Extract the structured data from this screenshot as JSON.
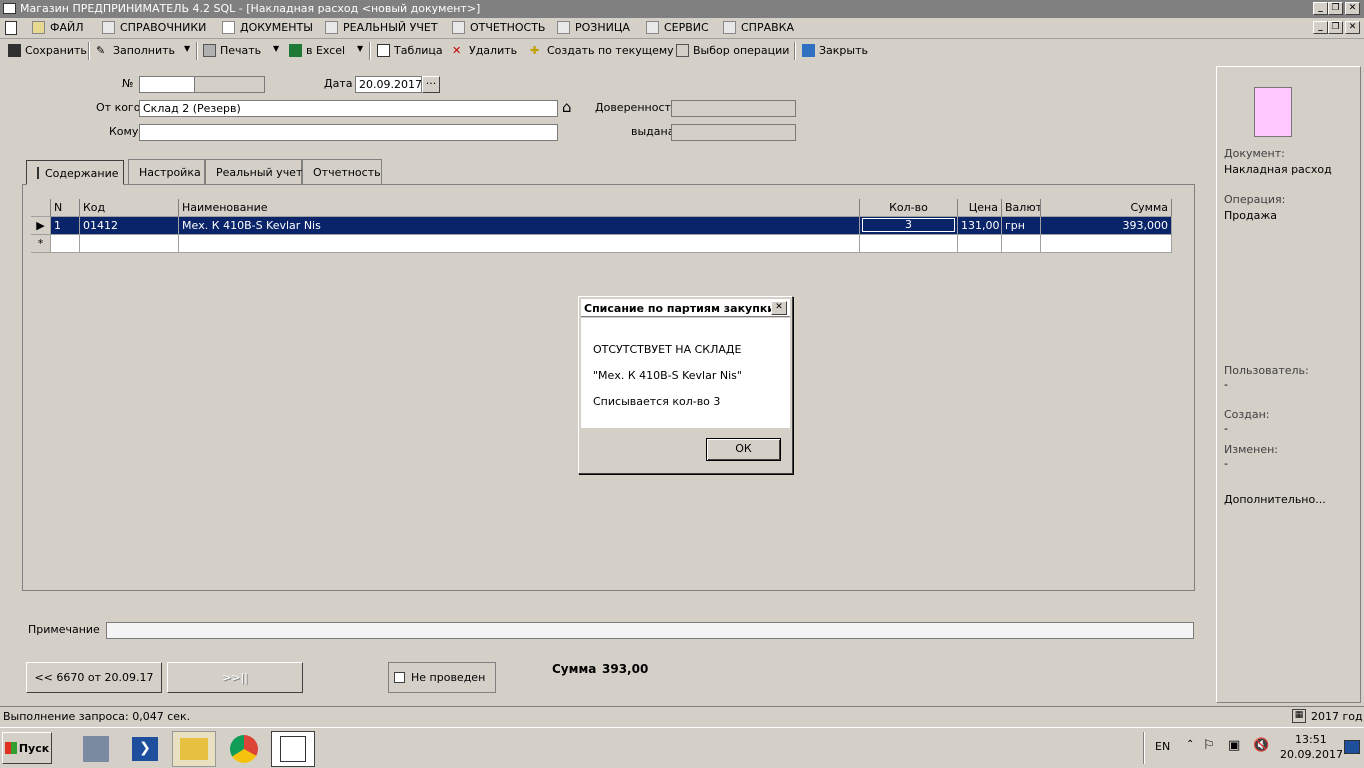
{
  "window": {
    "title": "Магазин  ПРЕДПРИНИМАТЕЛЬ 4.2 SQL - [Накладная расход <новый документ>]"
  },
  "menu": [
    {
      "label": "ФАЙЛ",
      "icon": "folder-icon"
    },
    {
      "label": "СПРАВОЧНИКИ",
      "icon": "home-icon"
    },
    {
      "label": "ДОКУМЕНТЫ",
      "icon": "document-icon"
    },
    {
      "label": "РЕАЛЬНЫЙ УЧЕТ",
      "icon": "ledger-icon"
    },
    {
      "label": "ОТЧЕТНОСТЬ",
      "icon": "report-icon"
    },
    {
      "label": "РОЗНИЦА",
      "icon": "cash-register-icon"
    },
    {
      "label": "СЕРВИС",
      "icon": "service-icon"
    },
    {
      "label": "СПРАВКА",
      "icon": "help-icon"
    }
  ],
  "toolbar": {
    "save": "Сохранить",
    "fill": "Заполнить",
    "print": "Печать",
    "excel": "в Excel",
    "table": "Таблица",
    "delete": "Удалить",
    "create_from_current": "Создать по текущему",
    "choose_operation": "Выбор операции",
    "close": "Закрыть"
  },
  "form": {
    "number_label": "№",
    "number_value": "",
    "date_label": "Дата",
    "date_value": "20.09.2017",
    "date_button": "···",
    "from_label": "От кого",
    "from_value": "Склад 2 (Резерв)",
    "to_label": "Кому",
    "to_value": "",
    "power_of_attorney_label": "Доверенность",
    "power_of_attorney_value": "",
    "issued_label": "выдана",
    "issued_value": ""
  },
  "tabs": [
    "Содержание",
    "Настройка",
    "Реальный учет",
    "Отчетность"
  ],
  "grid": {
    "headers": {
      "n": "N",
      "code": "Код",
      "name": "Наименование",
      "qty": "Кол-во",
      "price": "Цена",
      "currency": "Валют",
      "sum": "Сумма"
    },
    "rows": [
      {
        "n": "1",
        "code": "01412",
        "name": "Мех. К 410В-S Kevlar Nis",
        "qty": "3",
        "price": "131,00",
        "currency": "грн",
        "sum": "393,000"
      }
    ],
    "new_row_marker": "*"
  },
  "dialog": {
    "title": "Списание по партиям закупки",
    "line1": "ОТСУТСТВУЕТ НА СКЛАДЕ",
    "line2": "\"Мех. К 410В-S Kevlar Nis\"",
    "line3": "Списывается кол-во  3",
    "ok": "ОК"
  },
  "note": {
    "label": "Примечание",
    "value": ""
  },
  "bottom": {
    "prev_doc": "<< 6670 от 20.09.17",
    "next_doc": ">>||",
    "not_posted": "Не проведен",
    "sum_label": "Сумма",
    "sum_value": "393,00"
  },
  "side_panel": {
    "doc_label": "Документ:",
    "doc_value": "Накладная расход",
    "op_label": "Операция:",
    "op_value": "Продажа",
    "user_label": "Пользователь:",
    "user_value": "-",
    "created_label": "Создан:",
    "created_value": "-",
    "modified_label": "Изменен:",
    "modified_value": "-",
    "more": "Дополнительно..."
  },
  "status": {
    "query": "Выполнение запроса: 0,047 сек.",
    "year": "2017 год"
  },
  "taskbar": {
    "start": "Пуск",
    "lang": "EN",
    "time": "13:51",
    "date": "20.09.2017"
  },
  "colors": {
    "selection": "#0a246a",
    "face": "#d4d0c8",
    "doc_icon": "#ffc8ff"
  }
}
